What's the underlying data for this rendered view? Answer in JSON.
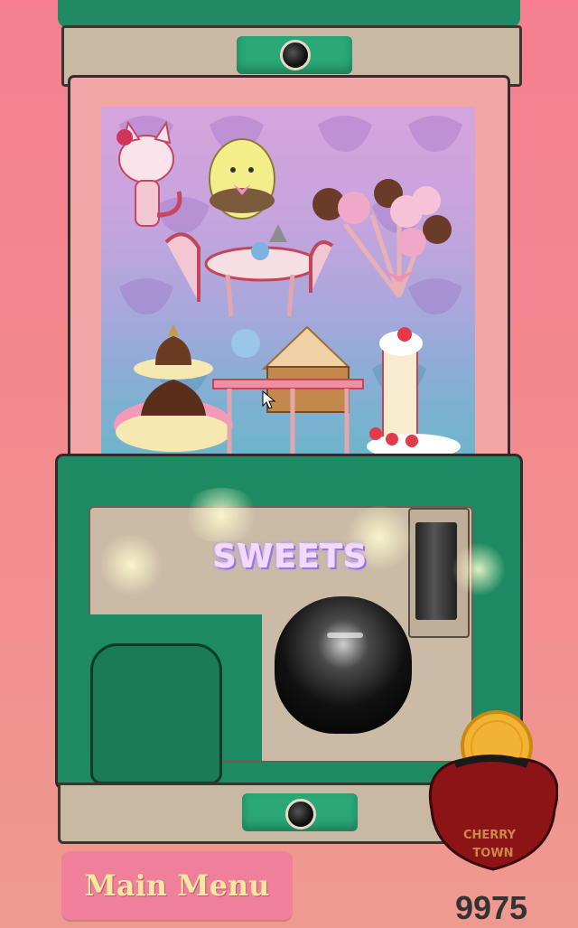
{
  "machine": {
    "theme_label": "SWEETS",
    "top_dial_icon": "dial-knob-icon",
    "bottom_dial_icon": "dial-knob-icon",
    "turn_knob_icon": "turn-knob-icon",
    "coin_slot_icon": "coin-slot-icon",
    "prize_chute_icon": "prize-chute-icon"
  },
  "display_items": [
    {
      "name": "pink-cat-figure"
    },
    {
      "name": "yellow-bird-figure"
    },
    {
      "name": "cake-pop-bouquet"
    },
    {
      "name": "tea-table-with-chairs"
    },
    {
      "name": "layered-cake-stand"
    },
    {
      "name": "gingerbread-house-table"
    },
    {
      "name": "strawberry-cake-slice"
    }
  ],
  "menu": {
    "main_menu_label": "Main Menu"
  },
  "wallet": {
    "coin_count": "9975",
    "purse_label_line1": "CHERRY",
    "purse_label_line2": "TOWN",
    "purse_icon": "coin-purse-icon",
    "coin_icon": "gold-coin-icon"
  },
  "colors": {
    "background": "#f57f8f",
    "machine_green": "#1e8a63",
    "panel_beige": "#cbbba6",
    "button_pink": "#ef7f9a",
    "button_text": "#f7e7a3"
  }
}
